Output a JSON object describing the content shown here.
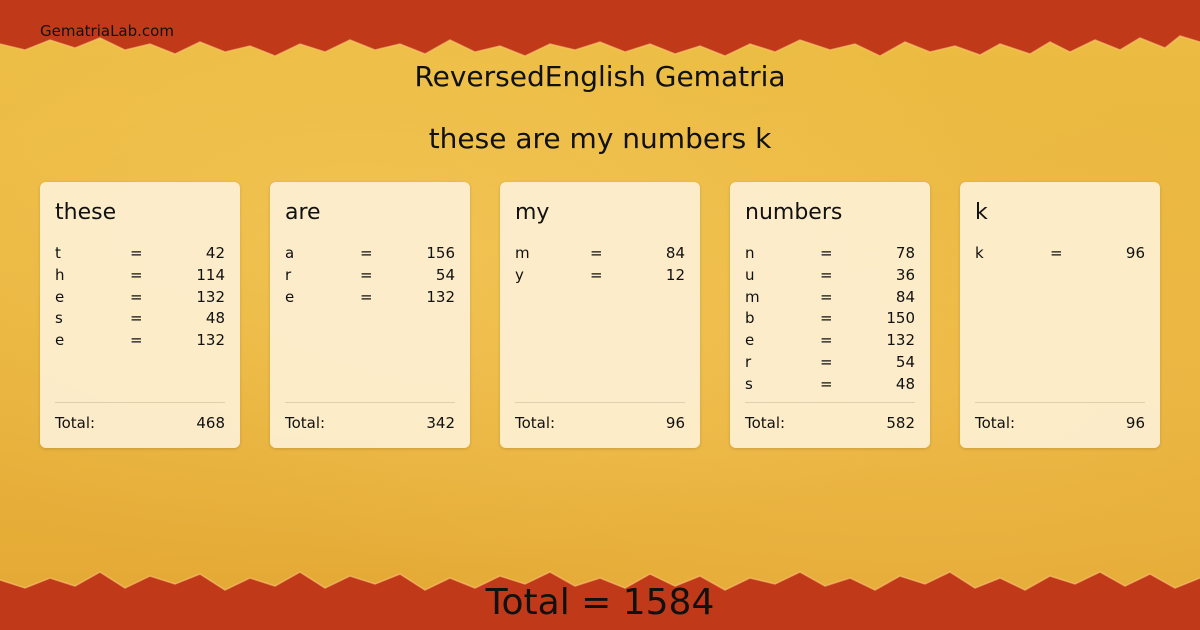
{
  "site": "GematriaLab.com",
  "title": "ReversedEnglish Gematria",
  "phrase": "these are my numbers k",
  "eq_symbol": "=",
  "total_label": "Total:",
  "grand_total": "Total = 1584",
  "colors": {
    "border": "#c23c1c",
    "background": "#e9b53a",
    "card": "#fdf0d4"
  },
  "cards": [
    {
      "word": "these",
      "letters": [
        {
          "l": "t",
          "v": "42"
        },
        {
          "l": "h",
          "v": "114"
        },
        {
          "l": "e",
          "v": "132"
        },
        {
          "l": "s",
          "v": "48"
        },
        {
          "l": "e",
          "v": "132"
        }
      ],
      "total": "468"
    },
    {
      "word": "are",
      "letters": [
        {
          "l": "a",
          "v": "156"
        },
        {
          "l": "r",
          "v": "54"
        },
        {
          "l": "e",
          "v": "132"
        }
      ],
      "total": "342"
    },
    {
      "word": "my",
      "letters": [
        {
          "l": "m",
          "v": "84"
        },
        {
          "l": "y",
          "v": "12"
        }
      ],
      "total": "96"
    },
    {
      "word": "numbers",
      "letters": [
        {
          "l": "n",
          "v": "78"
        },
        {
          "l": "u",
          "v": "36"
        },
        {
          "l": "m",
          "v": "84"
        },
        {
          "l": "b",
          "v": "150"
        },
        {
          "l": "e",
          "v": "132"
        },
        {
          "l": "r",
          "v": "54"
        },
        {
          "l": "s",
          "v": "48"
        }
      ],
      "total": "582"
    },
    {
      "word": "k",
      "letters": [
        {
          "l": "k",
          "v": "96"
        }
      ],
      "total": "96"
    }
  ]
}
